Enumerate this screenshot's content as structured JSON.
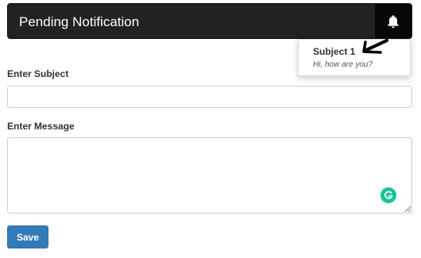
{
  "navbar": {
    "title": "Pending Notification",
    "bell_icon": "bell-icon"
  },
  "notifications": [
    {
      "subject": "Subject 1",
      "message": "Hi, how are you?"
    }
  ],
  "form": {
    "subject_label": "Enter Subject",
    "subject_value": "",
    "message_label": "Enter Message",
    "message_value": "",
    "save_label": "Save"
  },
  "icons": {
    "annotation": "arrow-annotation-icon",
    "grammarly": "grammarly-icon"
  },
  "colors": {
    "navbar_bg": "#222222",
    "bell_bg": "#080808",
    "primary": "#337ab7",
    "grammarly": "#15c39a"
  }
}
